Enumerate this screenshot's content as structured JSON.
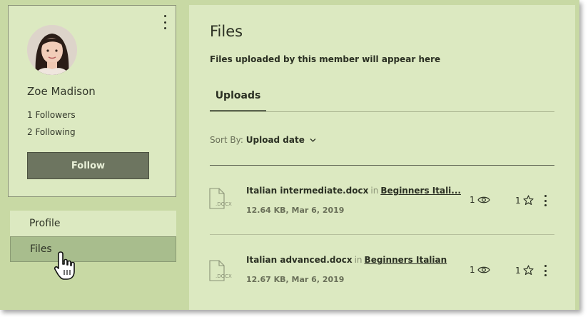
{
  "profile": {
    "name": "Zoe Madison",
    "followers": "1 Followers",
    "following": "2 Following",
    "follow_label": "Follow"
  },
  "nav": {
    "items": [
      {
        "label": "Profile"
      },
      {
        "label": "Files"
      }
    ]
  },
  "main": {
    "title": "Files",
    "subtitle": "Files uploaded by this member will appear here",
    "tab": "Uploads",
    "sort_label": "Sort By:",
    "sort_value": "Upload date"
  },
  "files": [
    {
      "name": "Italian intermediate.docx",
      "in": "in",
      "folder": "Beginners Itali...",
      "meta": "12.64 KB, Mar 6, 2019",
      "views": "1",
      "stars": "1",
      "ext": ".DOCX"
    },
    {
      "name": "Italian advanced.docx",
      "in": "in",
      "folder": "Beginners Italian",
      "meta": "12.67 KB, Mar 6, 2019",
      "views": "1",
      "stars": "1",
      "ext": ".DOCX"
    }
  ],
  "colors": {
    "background": "#c8d9a4",
    "panel": "#dce9c1",
    "button": "#6d7560",
    "nav_selected": "#a8bd8d"
  },
  "icons": [
    "more-vertical-icon",
    "file-icon",
    "eye-icon",
    "star-icon",
    "chevron-down-icon",
    "hand-cursor-icon"
  ]
}
